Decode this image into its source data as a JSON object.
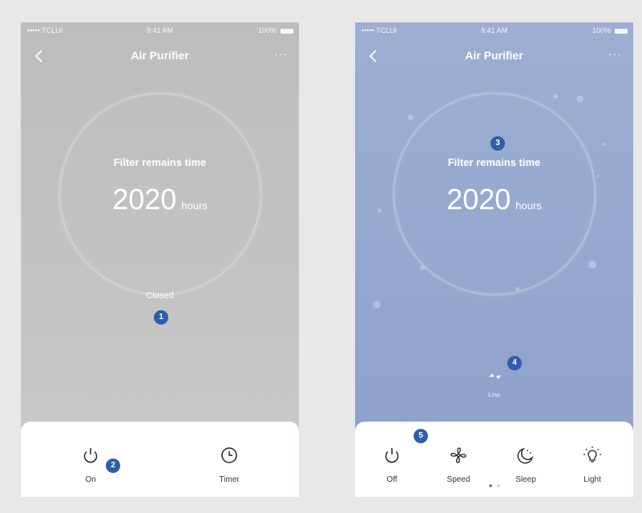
{
  "status_bar": {
    "carrier": "••••• TCLUI",
    "time": "9:41 AM",
    "battery": "100%"
  },
  "nav": {
    "title": "Air Purifier",
    "more": "···"
  },
  "filter": {
    "label": "Filter remains time",
    "value": "2020",
    "unit": "hours"
  },
  "left_screen": {
    "status_text": "Closed",
    "controls": [
      {
        "label": "On",
        "icon": "power-icon"
      },
      {
        "label": "Timer",
        "icon": "clock-icon"
      }
    ]
  },
  "right_screen": {
    "speed_label": "Low",
    "controls": [
      {
        "label": "Off",
        "icon": "power-icon"
      },
      {
        "label": "Speed",
        "icon": "fan-icon"
      },
      {
        "label": "Sleep",
        "icon": "moon-icon"
      },
      {
        "label": "Light",
        "icon": "bulb-icon"
      }
    ],
    "page_dots": {
      "count": 2,
      "active": 1
    }
  },
  "markers": [
    "1",
    "2",
    "3",
    "4",
    "5"
  ],
  "colors": {
    "marker": "#2f5faa",
    "right_bg": "#95a8cf",
    "left_bg": "#c3c3c3"
  }
}
